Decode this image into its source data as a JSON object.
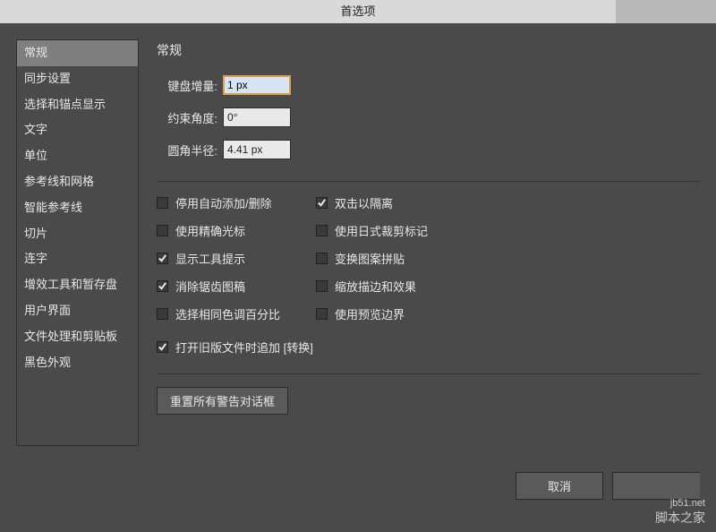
{
  "titlebar": {
    "title": "首选项"
  },
  "sidebar": {
    "items": [
      {
        "label": "常规",
        "selected": true
      },
      {
        "label": "同步设置",
        "selected": false
      },
      {
        "label": "选择和锚点显示",
        "selected": false
      },
      {
        "label": "文字",
        "selected": false
      },
      {
        "label": "单位",
        "selected": false
      },
      {
        "label": "参考线和网格",
        "selected": false
      },
      {
        "label": "智能参考线",
        "selected": false
      },
      {
        "label": "切片",
        "selected": false
      },
      {
        "label": "连字",
        "selected": false
      },
      {
        "label": "增效工具和暂存盘",
        "selected": false
      },
      {
        "label": "用户界面",
        "selected": false
      },
      {
        "label": "文件处理和剪贴板",
        "selected": false
      },
      {
        "label": "黑色外观",
        "selected": false
      }
    ]
  },
  "main": {
    "section_title": "常规",
    "fields": {
      "keyboard_increment": {
        "label": "键盘增量:",
        "value": "1 px"
      },
      "constrain_angle": {
        "label": "约束角度:",
        "value": "0°"
      },
      "corner_radius": {
        "label": "圆角半径:",
        "value": "4.41 px"
      }
    },
    "checks_left": [
      {
        "label": "停用自动添加/删除",
        "checked": false
      },
      {
        "label": "使用精确光标",
        "checked": false
      },
      {
        "label": "显示工具提示",
        "checked": true
      },
      {
        "label": "消除锯齿图稿",
        "checked": true
      },
      {
        "label": "选择相同色调百分比",
        "checked": false
      }
    ],
    "checks_right": [
      {
        "label": "双击以隔离",
        "checked": true
      },
      {
        "label": "使用日式裁剪标记",
        "checked": false
      },
      {
        "label": "变换图案拼贴",
        "checked": false
      },
      {
        "label": "缩放描边和效果",
        "checked": false
      },
      {
        "label": "使用预览边界",
        "checked": false
      }
    ],
    "check_full": {
      "label": "打开旧版文件时追加 [转换]",
      "checked": true
    },
    "reset_button": "重置所有警告对话框"
  },
  "buttons": {
    "cancel": "取消"
  },
  "watermark": {
    "line1": "jb51.net",
    "line2": "脚本之家"
  }
}
